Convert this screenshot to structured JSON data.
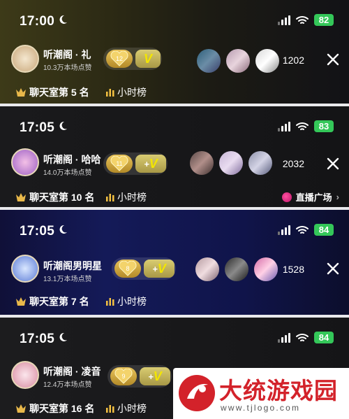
{
  "panels": [
    {
      "time": "17:00",
      "battery": "82",
      "room_name": "听潮阁 · 礼",
      "likes": "10.3万本场点赞",
      "level": "12",
      "viewer_count": "1202",
      "rank": "聊天室第 5 名",
      "hour_list": "小时榜"
    },
    {
      "time": "17:05",
      "battery": "83",
      "room_name": "听潮阁 · 哈哈",
      "likes": "14.0万本场点赞",
      "level": "11",
      "viewer_count": "2032",
      "rank": "聊天室第 10 名",
      "hour_list": "小时榜",
      "plaza": "直播广场",
      "plaza_arrow": "›"
    },
    {
      "time": "17:05",
      "battery": "84",
      "room_name": "听潮阁男明星",
      "likes": "13.1万本场点赞",
      "level": "8",
      "viewer_count": "1528",
      "rank": "聊天室第 7 名",
      "hour_list": "小时榜"
    },
    {
      "time": "17:05",
      "battery": "84",
      "room_name": "听潮阁 · 凌音",
      "likes": "12.4万本场点赞",
      "level": "9",
      "viewer_count": "",
      "rank": "聊天室第 16 名",
      "hour_list": "小时榜"
    }
  ],
  "badge_plus": "+",
  "badge_v": "V",
  "watermark": {
    "title": "大统游戏园",
    "url": "www.tjlogo.com"
  },
  "colors": {
    "battery": "#34c759",
    "gold": "#e8c35a",
    "accent_pink": "#ff4fa0",
    "watermark_red": "#d3222a"
  },
  "icons": [
    "moon-icon",
    "signal-icon",
    "wifi-icon",
    "battery-icon",
    "heart-level-icon",
    "v-badge-icon",
    "close-icon",
    "rank-crown-icon",
    "bar-chart-icon",
    "plaza-icon"
  ]
}
